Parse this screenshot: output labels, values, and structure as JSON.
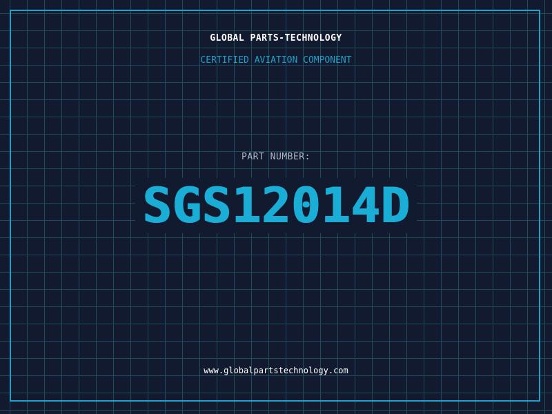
{
  "header": {
    "company_name": "GLOBAL PARTS-TECHNOLOGY",
    "subtitle": "CERTIFIED AVIATION COMPONENT"
  },
  "part": {
    "label": "PART NUMBER:",
    "number": "SGS12014D"
  },
  "footer": {
    "website": "www.globalpartstechnology.com"
  },
  "colors": {
    "background": "#111a2e",
    "grid": "#1d4c62",
    "accent": "#1fa2c9",
    "part_number": "#1aaed6",
    "text_primary": "#ffffff",
    "text_muted": "#aeb8c6"
  }
}
